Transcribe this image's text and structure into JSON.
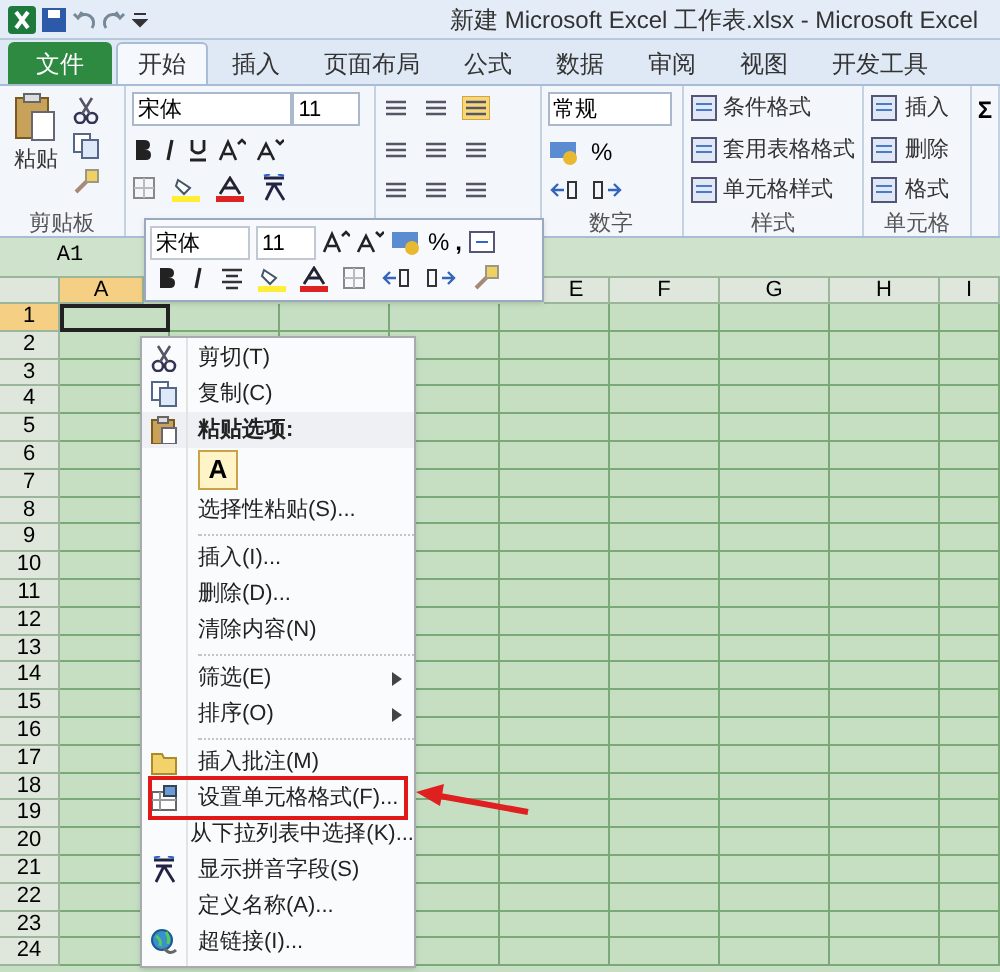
{
  "window": {
    "title": "新建 Microsoft Excel 工作表.xlsx - Microsoft Excel"
  },
  "tabs": [
    {
      "label": "文件",
      "kind": "file",
      "selected": false
    },
    {
      "label": "开始",
      "kind": "tab",
      "selected": true
    },
    {
      "label": "插入",
      "kind": "tab",
      "selected": false
    },
    {
      "label": "页面布局",
      "kind": "tab",
      "selected": false
    },
    {
      "label": "公式",
      "kind": "tab",
      "selected": false
    },
    {
      "label": "数据",
      "kind": "tab",
      "selected": false
    },
    {
      "label": "审阅",
      "kind": "tab",
      "selected": false
    },
    {
      "label": "视图",
      "kind": "tab",
      "selected": false
    },
    {
      "label": "开发工具",
      "kind": "tab",
      "selected": false
    }
  ],
  "ribbon": {
    "clipboard": {
      "paste": "粘贴",
      "label": "剪贴板"
    },
    "font": {
      "name": "宋体",
      "size": "11"
    },
    "number": {
      "format": "常规",
      "percent": "%",
      "label": "数字"
    },
    "styles": {
      "items": [
        "条件格式",
        "套用表格格式",
        "单元格样式"
      ],
      "label": "样式"
    },
    "cells": {
      "items": [
        "插入",
        "删除",
        "格式"
      ],
      "label": "单元格"
    },
    "editing": {
      "symbol": "Σ"
    }
  },
  "name_box": "A1",
  "mini_toolbar": {
    "font": "宋体",
    "size": "11",
    "percent": "%",
    "comma": ","
  },
  "columns": [
    {
      "label": "A",
      "selected": true
    },
    {
      "label": "E",
      "selected": false
    },
    {
      "label": "F",
      "selected": false
    },
    {
      "label": "G",
      "selected": false
    },
    {
      "label": "H",
      "selected": false
    },
    {
      "label": "I",
      "selected": false
    }
  ],
  "rows": [
    {
      "label": "1",
      "selected": true
    },
    {
      "label": "2",
      "selected": false
    },
    {
      "label": "3",
      "selected": false
    },
    {
      "label": "4",
      "selected": false
    },
    {
      "label": "5",
      "selected": false
    },
    {
      "label": "6",
      "selected": false
    },
    {
      "label": "7",
      "selected": false
    },
    {
      "label": "8",
      "selected": false
    },
    {
      "label": "9",
      "selected": false
    },
    {
      "label": "10",
      "selected": false
    },
    {
      "label": "11",
      "selected": false
    },
    {
      "label": "12",
      "selected": false
    },
    {
      "label": "13",
      "selected": false
    },
    {
      "label": "14",
      "selected": false
    },
    {
      "label": "15",
      "selected": false
    },
    {
      "label": "16",
      "selected": false
    },
    {
      "label": "17",
      "selected": false
    },
    {
      "label": "18",
      "selected": false
    },
    {
      "label": "19",
      "selected": false
    },
    {
      "label": "20",
      "selected": false
    },
    {
      "label": "21",
      "selected": false
    },
    {
      "label": "22",
      "selected": false
    },
    {
      "label": "23",
      "selected": false
    },
    {
      "label": "24",
      "selected": false
    }
  ],
  "context_menu": [
    {
      "kind": "item",
      "label": "剪切(T)"
    },
    {
      "kind": "item",
      "label": "复制(C)"
    },
    {
      "kind": "header",
      "label": "粘贴选项:"
    },
    {
      "kind": "paste",
      "label": "A"
    },
    {
      "kind": "item",
      "label": "选择性粘贴(S)..."
    },
    {
      "kind": "separator"
    },
    {
      "kind": "item",
      "label": "插入(I)..."
    },
    {
      "kind": "item",
      "label": "删除(D)..."
    },
    {
      "kind": "item",
      "label": "清除内容(N)"
    },
    {
      "kind": "separator"
    },
    {
      "kind": "submenu",
      "label": "筛选(E)"
    },
    {
      "kind": "submenu",
      "label": "排序(O)"
    },
    {
      "kind": "separator"
    },
    {
      "kind": "item",
      "label": "插入批注(M)"
    },
    {
      "kind": "item",
      "label": "设置单元格格式(F)...",
      "highlighted": true
    },
    {
      "kind": "item",
      "label": "从下拉列表中选择(K)..."
    },
    {
      "kind": "item",
      "label": "显示拼音字段(S)"
    },
    {
      "kind": "item",
      "label": "定义名称(A)..."
    },
    {
      "kind": "item",
      "label": "超链接(I)..."
    }
  ]
}
